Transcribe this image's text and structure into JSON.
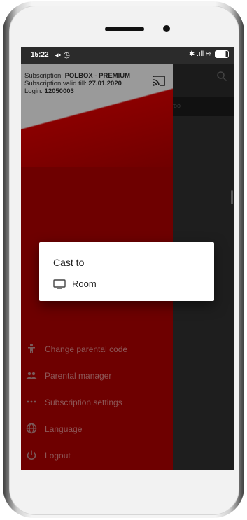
{
  "status_bar": {
    "time": "15:22",
    "left_icons": "◂• ◷",
    "right_icons": "✱ .ıll ≋"
  },
  "drawer": {
    "header": {
      "subscription_label": "Subscription: ",
      "subscription_value": "POLBOX - PREMIUM",
      "valid_label": "Subscription valid till: ",
      "valid_value": "27.01.2020",
      "login_label": "Login: ",
      "login_value": "12050003"
    },
    "menu": [
      {
        "label": "Change parental code",
        "icon": "person-icon"
      },
      {
        "label": "Parental manager",
        "icon": "people-icon"
      },
      {
        "label": "Subscription settings",
        "icon": "more-icon"
      },
      {
        "label": "Language",
        "icon": "globe-icon"
      },
      {
        "label": "Logout",
        "icon": "power-icon"
      }
    ]
  },
  "background_tab": "roo",
  "cast_dialog": {
    "title": "Cast to",
    "devices": [
      {
        "label": "Room",
        "icon": "tv-icon"
      }
    ]
  },
  "colors": {
    "drawer_red": "#6e0000",
    "header_gray": "#9a9a9a"
  }
}
